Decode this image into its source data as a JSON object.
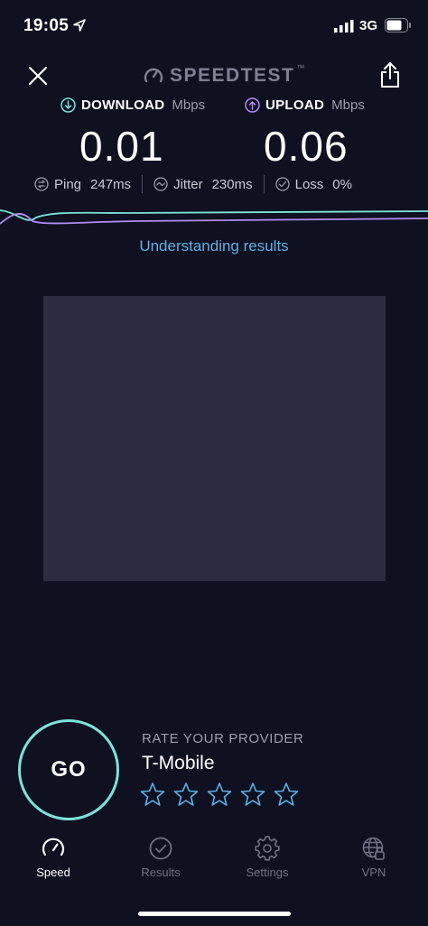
{
  "status_bar": {
    "time": "19:05",
    "network": "3G",
    "icons": [
      "location-arrow-icon",
      "signal-icon",
      "battery-icon"
    ]
  },
  "header": {
    "brand": "SPEEDTEST",
    "brand_mark": "™",
    "icons": [
      "close-icon",
      "speedometer-logo-icon",
      "share-icon"
    ]
  },
  "download": {
    "label": "DOWNLOAD",
    "unit": "Mbps",
    "value": "0.01",
    "icon": "download-arrow-icon",
    "color": "#7de3d8"
  },
  "upload": {
    "label": "UPLOAD",
    "unit": "Mbps",
    "value": "0.06",
    "icon": "upload-arrow-icon",
    "color": "#b28cf5"
  },
  "stats": {
    "ping": {
      "label": "Ping",
      "value": "247",
      "unit": "ms",
      "icon": "ping-icon"
    },
    "jitter": {
      "label": "Jitter",
      "value": "230",
      "unit": "ms",
      "icon": "jitter-icon"
    },
    "loss": {
      "label": "Loss",
      "value": "0",
      "unit": "%",
      "icon": "loss-icon"
    }
  },
  "understanding_link": "Understanding results",
  "go_button": "GO",
  "rating": {
    "title": "RATE YOUR PROVIDER",
    "provider": "T-Mobile",
    "stars_total": 5,
    "stars_selected": 0
  },
  "tabs": [
    {
      "label": "Speed",
      "icon": "speedometer-icon",
      "active": true
    },
    {
      "label": "Results",
      "icon": "checkmark-circle-icon",
      "active": false
    },
    {
      "label": "Settings",
      "icon": "gear-icon",
      "active": false
    },
    {
      "label": "VPN",
      "icon": "globe-lock-icon",
      "active": false
    }
  ],
  "colors": {
    "background": "#0f1121",
    "download_accent": "#7de3d8",
    "upload_accent": "#b28cf5",
    "link": "#5fb0e5",
    "ad_placeholder": "#2a2d3f"
  }
}
